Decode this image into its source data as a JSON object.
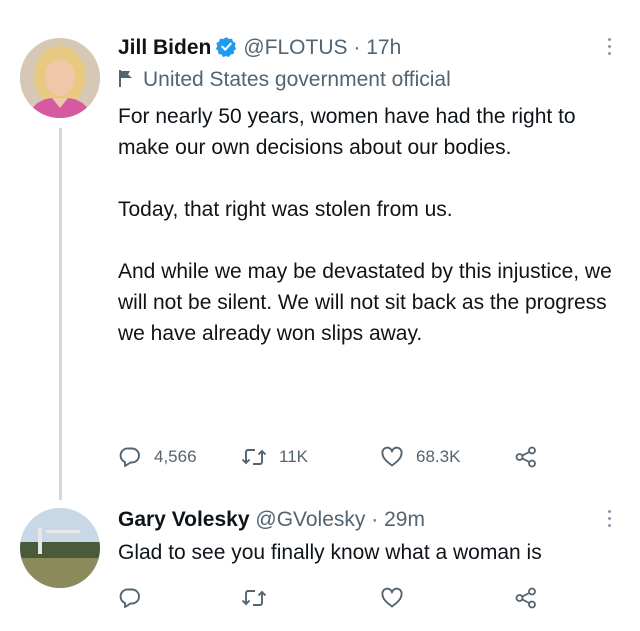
{
  "tweets": [
    {
      "author_name": "Jill Biden",
      "handle": "@FLOTUS",
      "separator": "·",
      "time": "17h",
      "verified": true,
      "label": "United States government official",
      "paragraphs": [
        "For nearly 50 years, women have had the right to make our own decisions about our bodies.",
        "Today, that right was stolen from us.",
        "And while we may be devastated by this injustice, we will not be silent. We will not sit back as the progress we have already won slips away."
      ],
      "reply_count": "4,566",
      "retweet_count": "11K",
      "like_count": "68.3K"
    },
    {
      "author_name": "Gary Volesky",
      "handle": "@GVolesky",
      "separator": "·",
      "time": "29m",
      "text": "Glad to see you finally know what a woman is"
    }
  ],
  "colors": {
    "text": "#0f1419",
    "secondary": "#536471",
    "verified_blue": "#1d9bf0",
    "thread_line": "#cfd9de"
  },
  "icons": [
    "verified-badge-icon",
    "flag-icon",
    "more-icon",
    "reply-icon",
    "retweet-icon",
    "like-icon",
    "share-icon"
  ]
}
